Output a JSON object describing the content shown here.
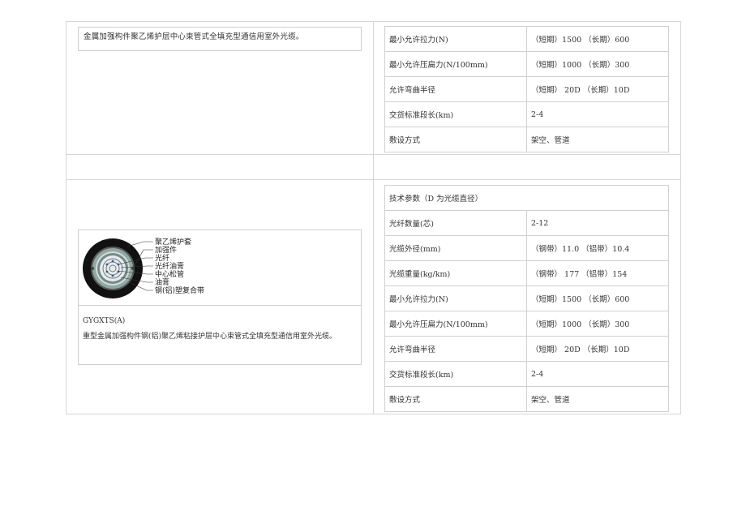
{
  "section1": {
    "description": "金属加强构件聚乙烯护层中心束管式全填充型通信用室外光缆。",
    "specs": [
      {
        "label": "最小允许拉力(N)",
        "value": "（短期）1500 （长期）600"
      },
      {
        "label": "最小允许压扁力(N/100mm)",
        "value": "（短期）1000 （长期）300"
      },
      {
        "label": "允许弯曲半径",
        "value": "（短期） 20D （长期）10D"
      },
      {
        "label": "交货标准段长(km)",
        "value": "2-4"
      },
      {
        "label": "敷设方式",
        "value": "架空、管道"
      }
    ]
  },
  "section2": {
    "diagram_labels": [
      "聚乙烯护套",
      "加强件",
      "光纤",
      "光纤油膏",
      "中心松管",
      "油膏",
      "钢(铝)塑复合带"
    ],
    "model": "GYGXTS(A)",
    "description": "重型金属加强构件钢(铝)聚乙烯粘接护层中心束管式全填充型通信用室外光缆。",
    "spec_header": "技术参数（D 为光缆直径）",
    "specs": [
      {
        "label": "光纤数量(芯)",
        "value": "2-12"
      },
      {
        "label": "光缆外径(mm)",
        "value": "（钢带）11.0 （铝带）10.4"
      },
      {
        "label": "光缆重量(kg/km)",
        "value": "（钢带） 177 （铝带）154"
      },
      {
        "label": "最小允许拉力(N)",
        "value": "（短期）1500 （长期）600"
      },
      {
        "label": "最小允许压扁力(N/100mm)",
        "value": "（短期）1000 （长期）300"
      },
      {
        "label": "允许弯曲半径",
        "value": "（短期） 20D （长期）10D"
      },
      {
        "label": "交货标准段长(km)",
        "value": "2-4"
      },
      {
        "label": "敷设方式",
        "value": "架空、管道"
      }
    ]
  }
}
